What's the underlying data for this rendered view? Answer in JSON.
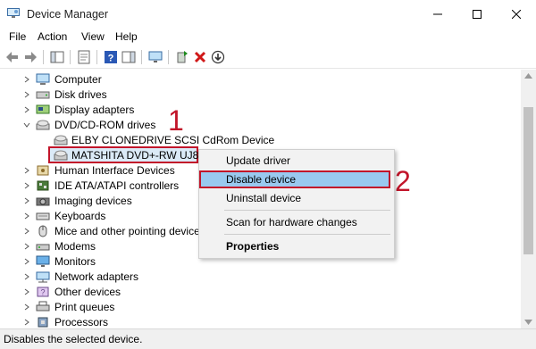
{
  "window": {
    "title": "Device Manager"
  },
  "menubar": {
    "items": [
      "File",
      "Action",
      "View",
      "Help"
    ]
  },
  "tree": {
    "items": [
      {
        "label": "Computer",
        "icon": "computer-icon",
        "expanded": false
      },
      {
        "label": "Disk drives",
        "icon": "disk-drive-icon",
        "expanded": false
      },
      {
        "label": "Display adapters",
        "icon": "display-adapter-icon",
        "expanded": false
      },
      {
        "label": "DVD/CD-ROM drives",
        "icon": "dvd-drive-icon",
        "expanded": true
      },
      {
        "label": "ELBY CLONEDRIVE SCSI CdRom Device",
        "icon": "dvd-drive-icon",
        "child": true
      },
      {
        "label": "MATSHITA DVD+-RW UJ8D1",
        "icon": "dvd-drive-icon",
        "child": true,
        "selected": true
      },
      {
        "label": "Human Interface Devices",
        "icon": "hid-icon",
        "expanded": false
      },
      {
        "label": "IDE ATA/ATAPI controllers",
        "icon": "ide-controller-icon",
        "expanded": false
      },
      {
        "label": "Imaging devices",
        "icon": "camera-icon",
        "expanded": false
      },
      {
        "label": "Keyboards",
        "icon": "keyboard-icon",
        "expanded": false
      },
      {
        "label": "Mice and other pointing devices",
        "icon": "mouse-icon",
        "expanded": false
      },
      {
        "label": "Modems",
        "icon": "modem-icon",
        "expanded": false
      },
      {
        "label": "Monitors",
        "icon": "monitor-icon",
        "expanded": false
      },
      {
        "label": "Network adapters",
        "icon": "network-adapter-icon",
        "expanded": false
      },
      {
        "label": "Other devices",
        "icon": "other-devices-icon",
        "expanded": false
      },
      {
        "label": "Print queues",
        "icon": "printer-icon",
        "expanded": false
      },
      {
        "label": "Processors",
        "icon": "processor-icon",
        "expanded": false
      }
    ]
  },
  "context_menu": {
    "items": [
      "Update driver",
      "Disable device",
      "Uninstall device",
      "Scan for hardware changes",
      "Properties"
    ],
    "highlighted": "Disable device"
  },
  "annotations": {
    "step1": "1",
    "step2": "2"
  },
  "statusbar": {
    "text": "Disables the selected device."
  },
  "colors": {
    "annotation_red": "#c2152a",
    "menu_highlight": "#99c9ef"
  }
}
